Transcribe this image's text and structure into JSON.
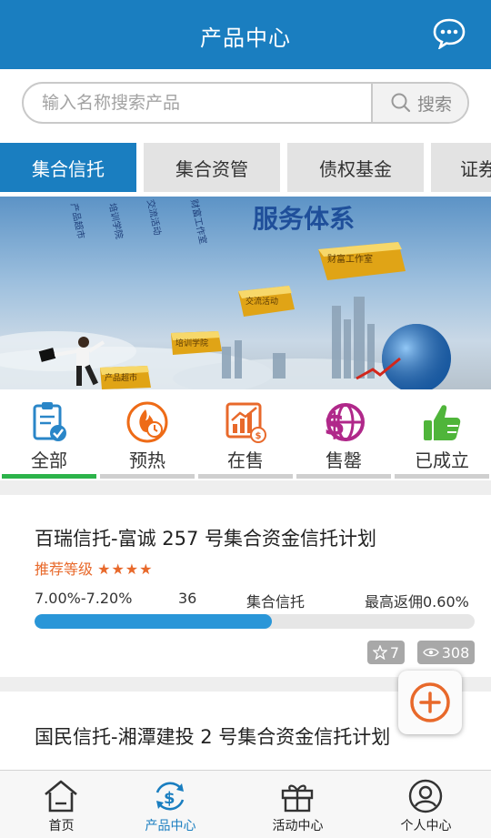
{
  "header": {
    "title": "产品中心",
    "chat_icon": "chat-bubble-icon"
  },
  "search": {
    "placeholder": "输入名称搜索产品",
    "button_label": "搜索"
  },
  "category_tabs": [
    {
      "label": "集合信托",
      "active": true
    },
    {
      "label": "集合资管",
      "active": false
    },
    {
      "label": "债权基金",
      "active": false
    },
    {
      "label": "证券",
      "active": false
    }
  ],
  "banner": {
    "headline": "服务体系",
    "bars": [
      "财富工作室",
      "交流活动",
      "培训学院",
      "产品超市"
    ],
    "columns": [
      "产品超市",
      "培训学院",
      "交流活动",
      "财富工作室"
    ]
  },
  "status_filters": [
    {
      "label": "全部",
      "icon": "clipboard-check-icon",
      "active": true
    },
    {
      "label": "预热",
      "icon": "flame-clock-icon",
      "active": false
    },
    {
      "label": "在售",
      "icon": "chart-coin-icon",
      "active": false
    },
    {
      "label": "售罄",
      "icon": "dollar-globe-icon",
      "active": false
    },
    {
      "label": "已成立",
      "icon": "thumbs-up-icon",
      "active": false
    }
  ],
  "products": [
    {
      "name": "百瑞信托-富诚 257 号集合资金信托计划",
      "recommend_label": "推荐等级",
      "stars": "★★★★",
      "rate": "7.00%-7.20%",
      "term": "36",
      "type": "集合信托",
      "commission": "最高返佣0.60%",
      "progress_percent": 54,
      "favorites": "7",
      "views": "308"
    },
    {
      "name": "国民信托-湘潭建投 2 号集合资金信托计划"
    }
  ],
  "bottom_nav": [
    {
      "label": "首页",
      "icon": "home-icon",
      "active": false
    },
    {
      "label": "产品中心",
      "icon": "dollar-refresh-icon",
      "active": true
    },
    {
      "label": "活动中心",
      "icon": "gift-icon",
      "active": false
    },
    {
      "label": "个人中心",
      "icon": "user-icon",
      "active": false
    }
  ],
  "colors": {
    "brand": "#1a7ec0",
    "accent": "#e8692b",
    "active_filter": "#2cb34a",
    "progress": "#2a96d8"
  }
}
